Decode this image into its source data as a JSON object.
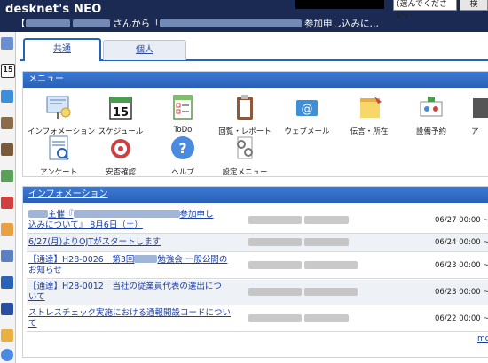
{
  "header": {
    "logo": "desknet's NEO",
    "notice_prefix": "【",
    "notice_mid": "さんから「",
    "notice_suffix": "参加申し込みに…",
    "select_value": "(選んでください)",
    "button_label": "検"
  },
  "tabs": [
    {
      "label": "共通",
      "active": true
    },
    {
      "label": "個人",
      "active": false
    }
  ],
  "menu": {
    "title": "メニュー",
    "items": [
      {
        "label": "インフォメーション",
        "icon": "information-board-icon"
      },
      {
        "label": "スケジュール",
        "icon": "calendar-icon",
        "day": "15"
      },
      {
        "label": "ToDo",
        "icon": "todo-checklist-icon"
      },
      {
        "label": "回覧・レポート",
        "icon": "clipboard-icon"
      },
      {
        "label": "ウェブメール",
        "icon": "envelope-at-icon"
      },
      {
        "label": "伝言・所在",
        "icon": "sticky-note-icon"
      },
      {
        "label": "設備予約",
        "icon": "facility-reservation-icon"
      },
      {
        "label": "ア",
        "icon": "partial-icon"
      },
      {
        "label": "アンケート",
        "icon": "survey-icon"
      },
      {
        "label": "安否確認",
        "icon": "safety-confirmation-icon"
      },
      {
        "label": "ヘルプ",
        "icon": "help-question-icon"
      },
      {
        "label": "設定メニュー",
        "icon": "settings-gears-icon"
      }
    ]
  },
  "information": {
    "title": "インフォメーション",
    "rows": [
      {
        "line1_a": "",
        "line1_b": "主催『",
        "line1_c": "参加申し",
        "line2": "込みについて』 8月6日（土）",
        "date": "06/27 00:00 ~"
      },
      {
        "line1_a": "6/27(月)よりOJTがスタートします",
        "line1_b": "",
        "line1_c": "",
        "line2": "",
        "date": "06/24 00:00 ~"
      },
      {
        "line1_a": "【通達】H28-0026　第3回",
        "line1_b": "勉強会 一般公開の",
        "line1_c": "",
        "line2": "お知らせ",
        "date": "06/23 00:00 ~"
      },
      {
        "line1_a": "【通達】H28-0012　当社の従業員代表の選出につ",
        "line1_b": "",
        "line1_c": "",
        "line2": "いて",
        "date": "06/23 00:00 ~"
      },
      {
        "line1_a": "ストレスチェック実施における通報開設コードについ",
        "line1_b": "",
        "line1_c": "",
        "line2": "て",
        "date": "06/22 00:00 ~"
      }
    ],
    "more": "mo"
  }
}
